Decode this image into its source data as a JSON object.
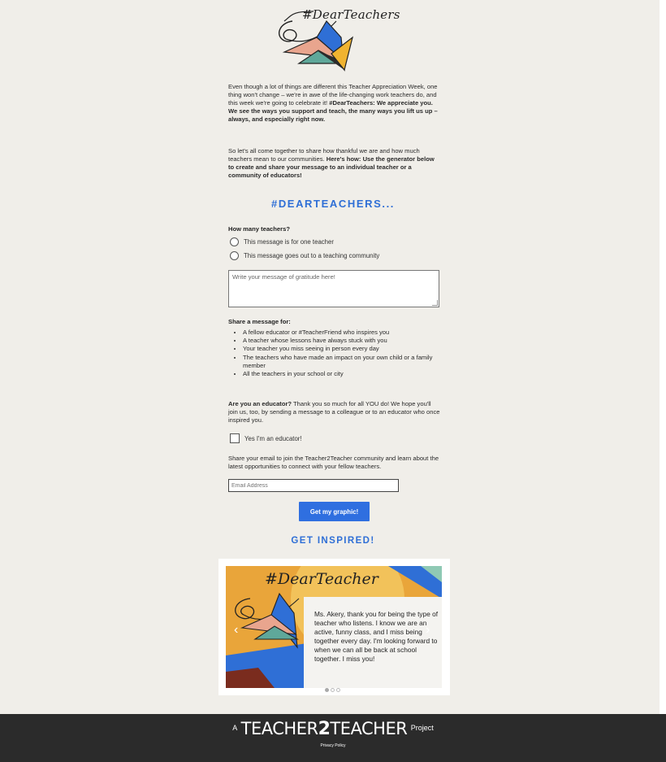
{
  "header": {
    "logo_text": "#DearTeachers"
  },
  "intro": {
    "paragraph1_plain": "Even though a lot of things are different this Teacher Appreciation Week, one thing won't change – we're in awe of the life-changing work teachers do, and this week we're going to celebrate it! ",
    "paragraph1_bold": "#DearTeachers: We appreciate you. We see the ways you support and teach, the many ways you lift us up – always, and especially right now.",
    "paragraph2_plain": "So let's all come together to share how thankful we are and how much teachers mean to our communities. ",
    "paragraph2_bold": "Here's how: Use the generator below to create and share your message to an individual teacher or a community of educators!"
  },
  "form": {
    "heading": "#DEARTEACHERS...",
    "how_many_label": "How many teachers?",
    "radio_one": "This message is for one teacher",
    "radio_community": "This message goes out to a teaching community",
    "message_placeholder": "Write your message of gratitude here!",
    "share_label": "Share a message for:",
    "share_items": [
      "A fellow educator or #TeacherFriend who inspires you",
      "A teacher whose lessons have always stuck with you",
      "Your teacher you miss seeing in person every day",
      "The teachers who have made an impact on your own child or a family member",
      "All the teachers in your school or city"
    ],
    "educator_bold": "Are you an educator?",
    "educator_text": " Thank you so much for all YOU do! We hope you'll join us, too, by sending a message to a colleague or to an educator who once inspired you.",
    "educator_checkbox": "Yes I'm an educator!",
    "email_text": "Share your email to join the Teacher2Teacher community and learn about the latest opportunities to connect with your fellow teachers.",
    "email_placeholder": "Email Address",
    "submit_label": "Get my graphic!"
  },
  "inspire": {
    "heading": "GET INSPIRED!",
    "card_title": "#DearTeacher",
    "card_message": "Ms. Akery, thank you for being the type of teacher who listens. I know we are an active, funny class, and I miss being together every day. I'm looking forward to when we can all be back at school together. I miss you!",
    "prev_arrow": "‹",
    "next_arrow": "›"
  },
  "footer": {
    "prefix": "A",
    "brand_part1": "TEACHER",
    "brand_two": "2",
    "brand_part2": "TEACHER",
    "suffix": "Project",
    "privacy": "Privacy Policy"
  },
  "colors": {
    "accent_blue": "#2f6fd6",
    "button_blue": "#2f6fe0",
    "footer_bg": "#2b2b2b",
    "page_bg": "#f0eee9"
  }
}
